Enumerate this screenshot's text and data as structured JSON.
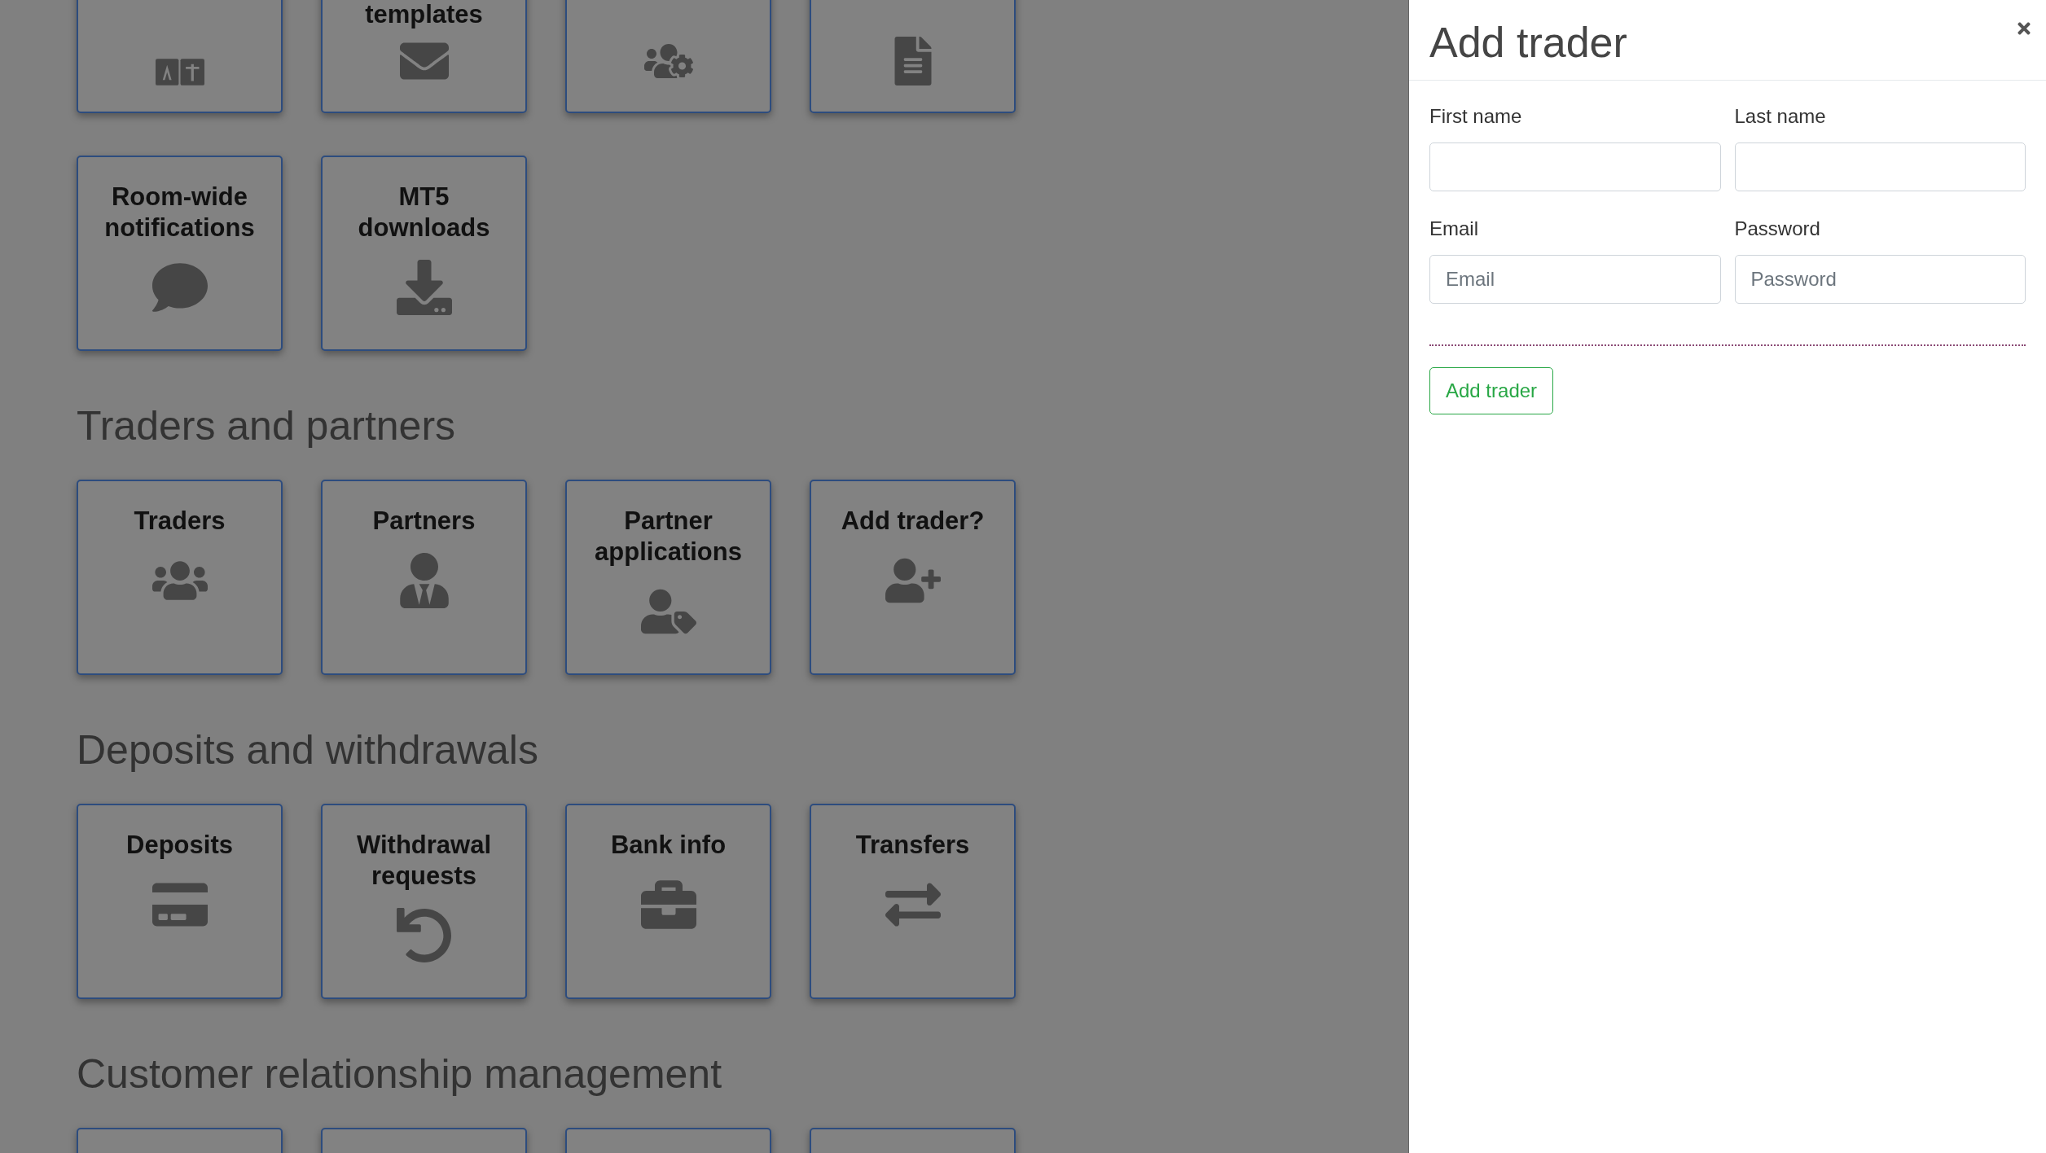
{
  "dashboard": {
    "sections": [
      {
        "tiles": [
          {
            "kind": "link-tile"
          },
          {
            "kind": "link-tile",
            "title": "templates"
          },
          {
            "kind": "link-tile"
          },
          {
            "kind": "link-tile"
          },
          {
            "kind": "link-tile",
            "title": "Room-wide notifications"
          },
          {
            "kind": "link-tile",
            "title": "MT5 downloads"
          }
        ]
      },
      {
        "heading": "Traders and partners",
        "tiles": [
          {
            "kind": "link-tile",
            "title": "Traders"
          },
          {
            "kind": "link-tile",
            "title": "Partners"
          },
          {
            "kind": "link-tile",
            "title": "Partner applications"
          },
          {
            "kind": "link-tile",
            "title": "Add trader?"
          }
        ]
      },
      {
        "heading": "Deposits and withdrawals",
        "tiles": [
          {
            "kind": "link-tile",
            "title": "Deposits"
          },
          {
            "kind": "link-tile",
            "title": "Withdrawal requests"
          },
          {
            "kind": "link-tile",
            "title": "Bank info"
          },
          {
            "kind": "link-tile",
            "title": "Transfers"
          }
        ]
      },
      {
        "heading": "Customer relationship management",
        "tiles": [
          {
            "kind": "link-tile"
          },
          {
            "kind": "link-tile"
          },
          {
            "kind": "link-tile"
          },
          {
            "kind": "link-tile"
          }
        ]
      }
    ]
  },
  "panel": {
    "title": "Add trader",
    "fields": [
      {
        "label": "First name"
      },
      {
        "label": "Last name"
      },
      {
        "label": "Email",
        "placeholder": "Email"
      },
      {
        "label": "Password",
        "placeholder": "Password"
      }
    ],
    "button": "Add trader"
  }
}
